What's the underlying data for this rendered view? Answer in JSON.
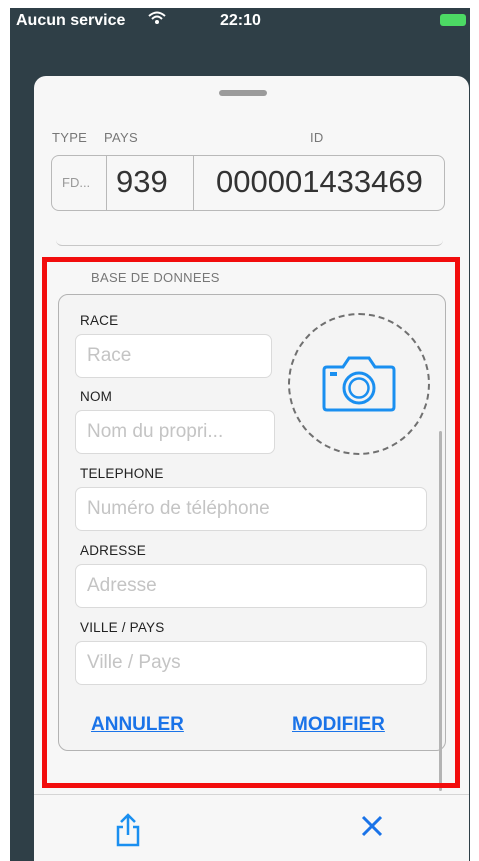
{
  "status_bar": {
    "carrier": "Aucun service",
    "time": "22:10"
  },
  "id_section": {
    "type_label": "TYPE",
    "country_label": "PAYS",
    "id_label": "ID",
    "type_value": "FD...",
    "country_value": "939",
    "id_value": "000001433469"
  },
  "database": {
    "title": "BASE DE DONNEES",
    "race_label": "RACE",
    "race_placeholder": "Race",
    "name_label": "NOM",
    "name_placeholder": "Nom du propri...",
    "phone_label": "TELEPHONE",
    "phone_placeholder": "Numéro de téléphone",
    "address_label": "ADRESSE",
    "address_placeholder": "Adresse",
    "city_label": "VILLE / PAYS",
    "city_placeholder": "Ville / Pays",
    "cancel_label": "ANNULER",
    "modify_label": "MODIFIER"
  },
  "toolbar": {
    "share_icon": "share-icon",
    "close_icon": "close-icon"
  },
  "colors": {
    "accent": "#1a73e8",
    "highlight": "#f20d0d",
    "background": "#2f3f47"
  }
}
